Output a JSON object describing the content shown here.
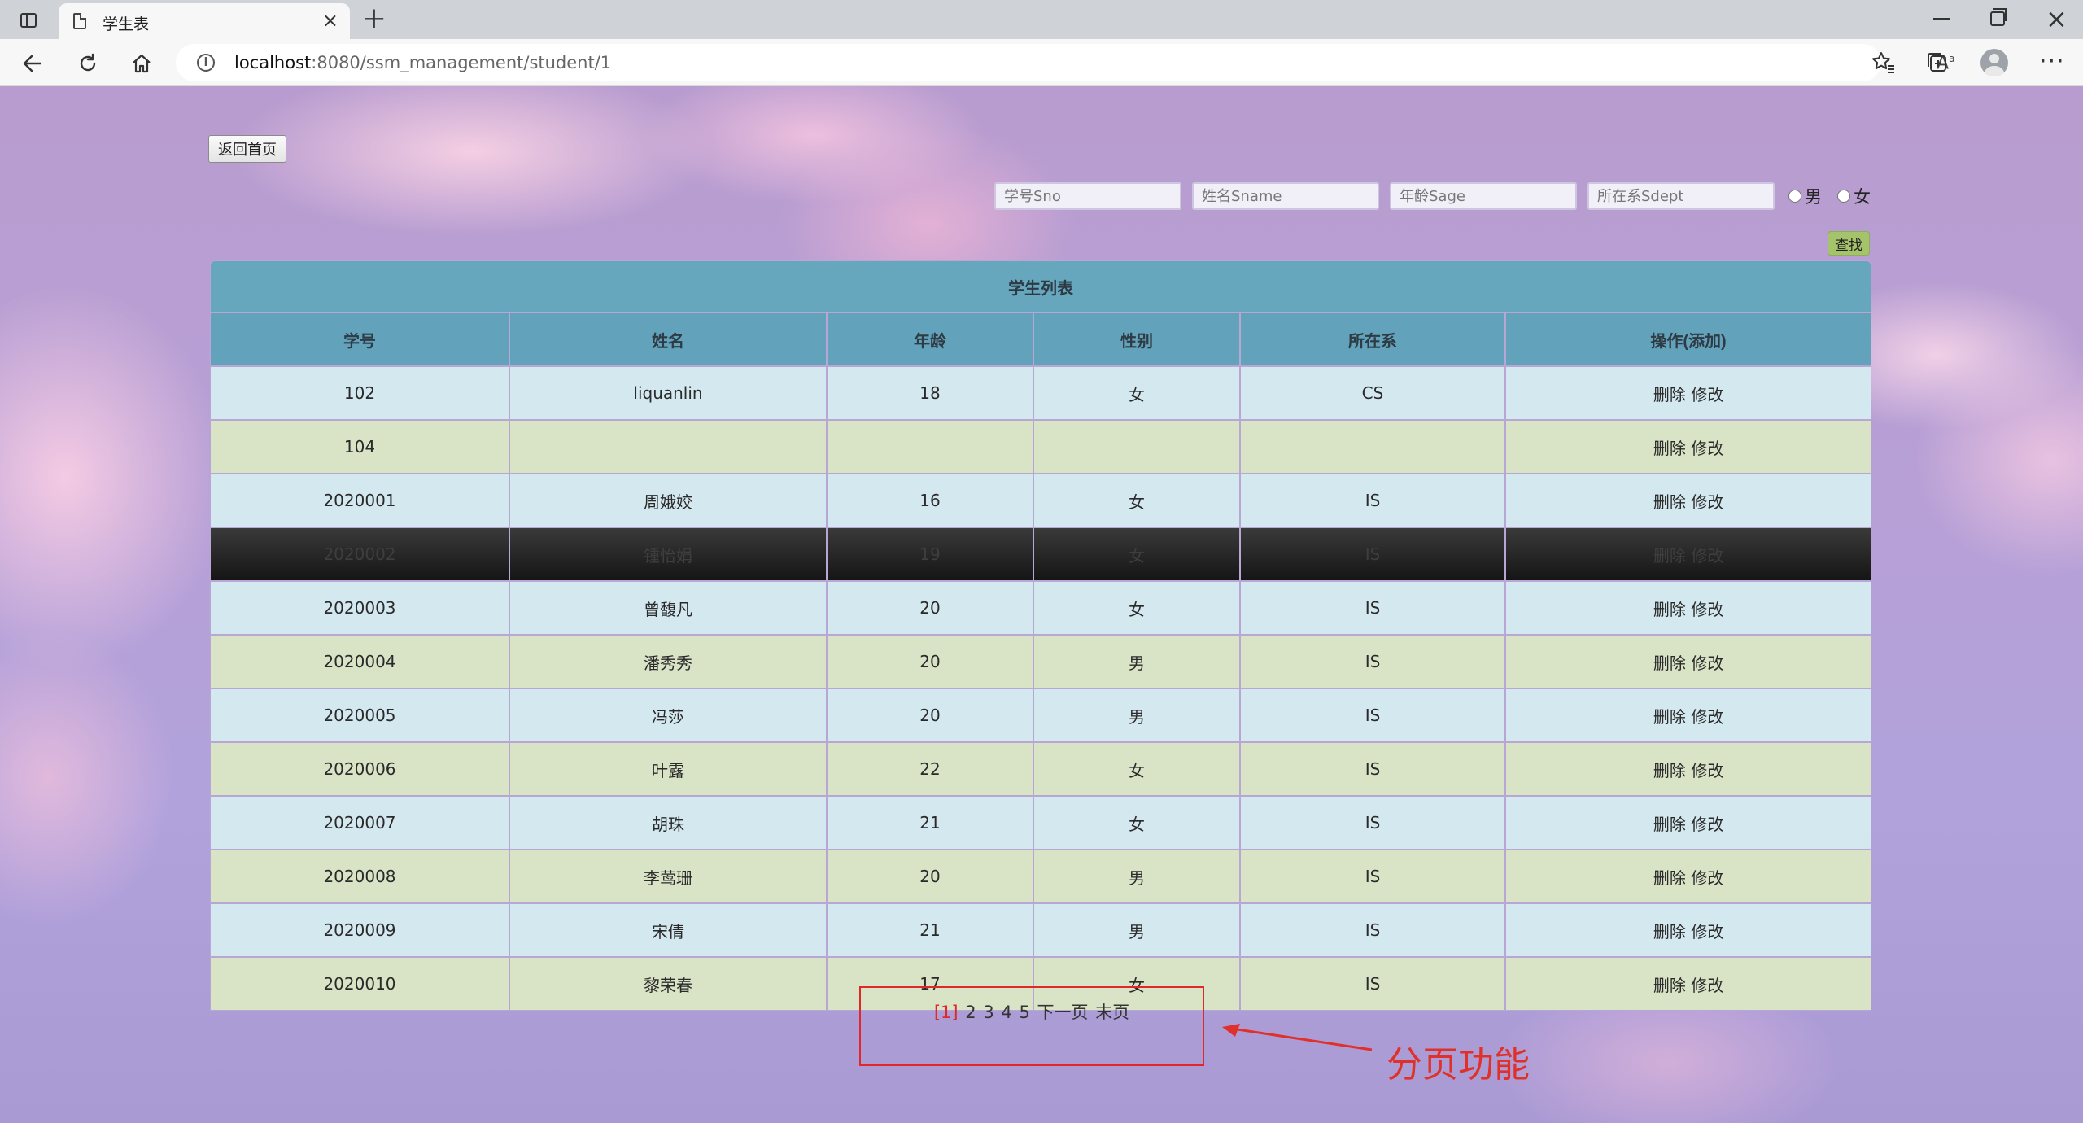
{
  "browser": {
    "tab_title": "学生表",
    "url_host": "localhost",
    "url_rest": ":8080/ssm_management/student/1"
  },
  "page": {
    "home_button": "返回首页",
    "search": {
      "sno_placeholder": "学号Sno",
      "sname_placeholder": "姓名Sname",
      "sage_placeholder": "年龄Sage",
      "sdept_placeholder": "所在系Sdept",
      "gender_male": "男",
      "gender_female": "女",
      "find_button": "查找"
    },
    "table": {
      "caption": "学生列表",
      "headers": [
        "学号",
        "姓名",
        "年龄",
        "性别",
        "所在系",
        "操作(添加)"
      ],
      "delete_label": "删除",
      "edit_label": "修改",
      "rows": [
        {
          "sno": "102",
          "sname": "liquanlin",
          "sage": "18",
          "ssex": "女",
          "sdept": "CS"
        },
        {
          "sno": "104",
          "sname": "",
          "sage": "",
          "ssex": "",
          "sdept": ""
        },
        {
          "sno": "2020001",
          "sname": "周娥姣",
          "sage": "16",
          "ssex": "女",
          "sdept": "IS"
        },
        {
          "sno": "2020002",
          "sname": "锺怡娟",
          "sage": "19",
          "ssex": "女",
          "sdept": "IS"
        },
        {
          "sno": "2020003",
          "sname": "曾馥凡",
          "sage": "20",
          "ssex": "女",
          "sdept": "IS"
        },
        {
          "sno": "2020004",
          "sname": "潘秀秀",
          "sage": "20",
          "ssex": "男",
          "sdept": "IS"
        },
        {
          "sno": "2020005",
          "sname": "冯莎",
          "sage": "20",
          "ssex": "男",
          "sdept": "IS"
        },
        {
          "sno": "2020006",
          "sname": "叶露",
          "sage": "22",
          "ssex": "女",
          "sdept": "IS"
        },
        {
          "sno": "2020007",
          "sname": "胡珠",
          "sage": "21",
          "ssex": "女",
          "sdept": "IS"
        },
        {
          "sno": "2020008",
          "sname": "李莺珊",
          "sage": "20",
          "ssex": "男",
          "sdept": "IS"
        },
        {
          "sno": "2020009",
          "sname": "宋倩",
          "sage": "21",
          "ssex": "男",
          "sdept": "IS"
        },
        {
          "sno": "2020010",
          "sname": "黎荣春",
          "sage": "17",
          "ssex": "女",
          "sdept": "IS"
        }
      ]
    },
    "pagination": {
      "current": "[1]",
      "pages": [
        "2",
        "3",
        "4",
        "5"
      ],
      "next": "下一页",
      "last": "末页"
    },
    "annotation": "分页功能"
  }
}
